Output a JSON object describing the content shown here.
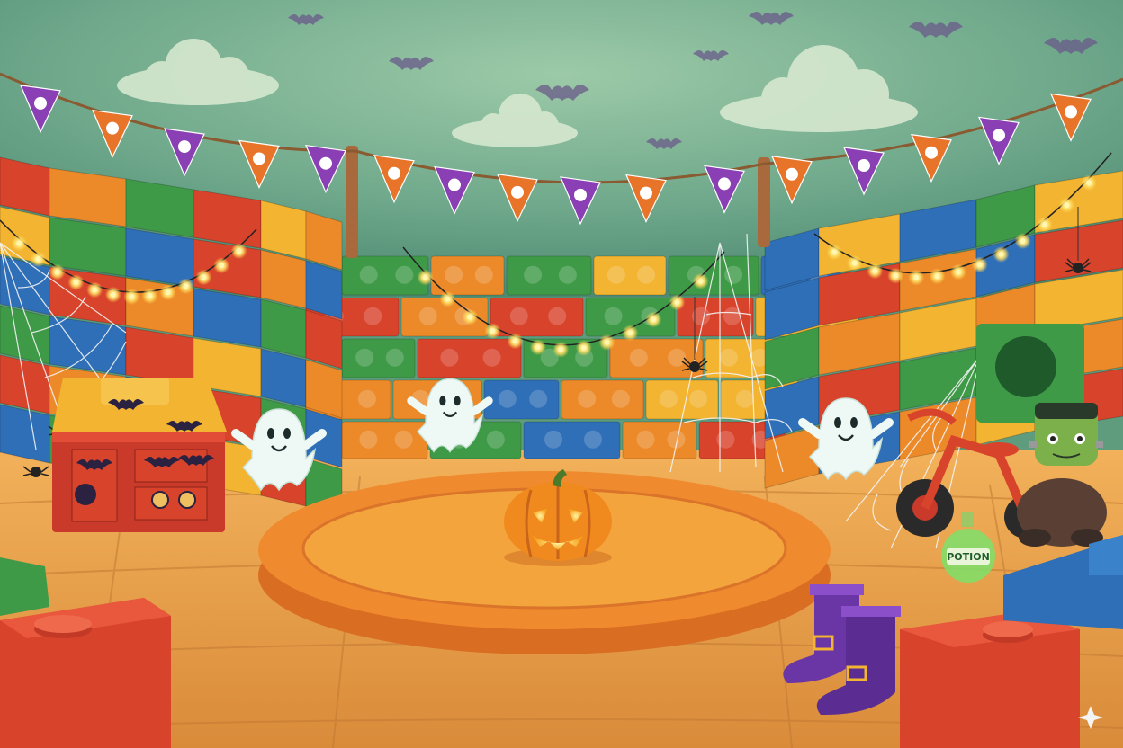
{
  "scene": {
    "theme": "halloween-toy-brick-arena",
    "colors": {
      "sky": "#6ea98a",
      "floor": "#e8a44a",
      "arena_ring": "#e9852e",
      "arena_inner": "#f0a03c",
      "brick_red": "#d8432c",
      "brick_orange": "#ec8a2a",
      "brick_yellow": "#f2b431",
      "brick_green": "#3f9a48",
      "brick_blue": "#2f6fb7",
      "pennant_purple": "#8a3fb4",
      "pennant_orange": "#e8742a",
      "witch_boot": "#6a35a5"
    }
  },
  "props": {
    "potion_label": "POTION"
  },
  "icons": [
    "ghost-icon",
    "pumpkin-icon",
    "bat-icon",
    "spider-icon",
    "sparkle-icon"
  ]
}
